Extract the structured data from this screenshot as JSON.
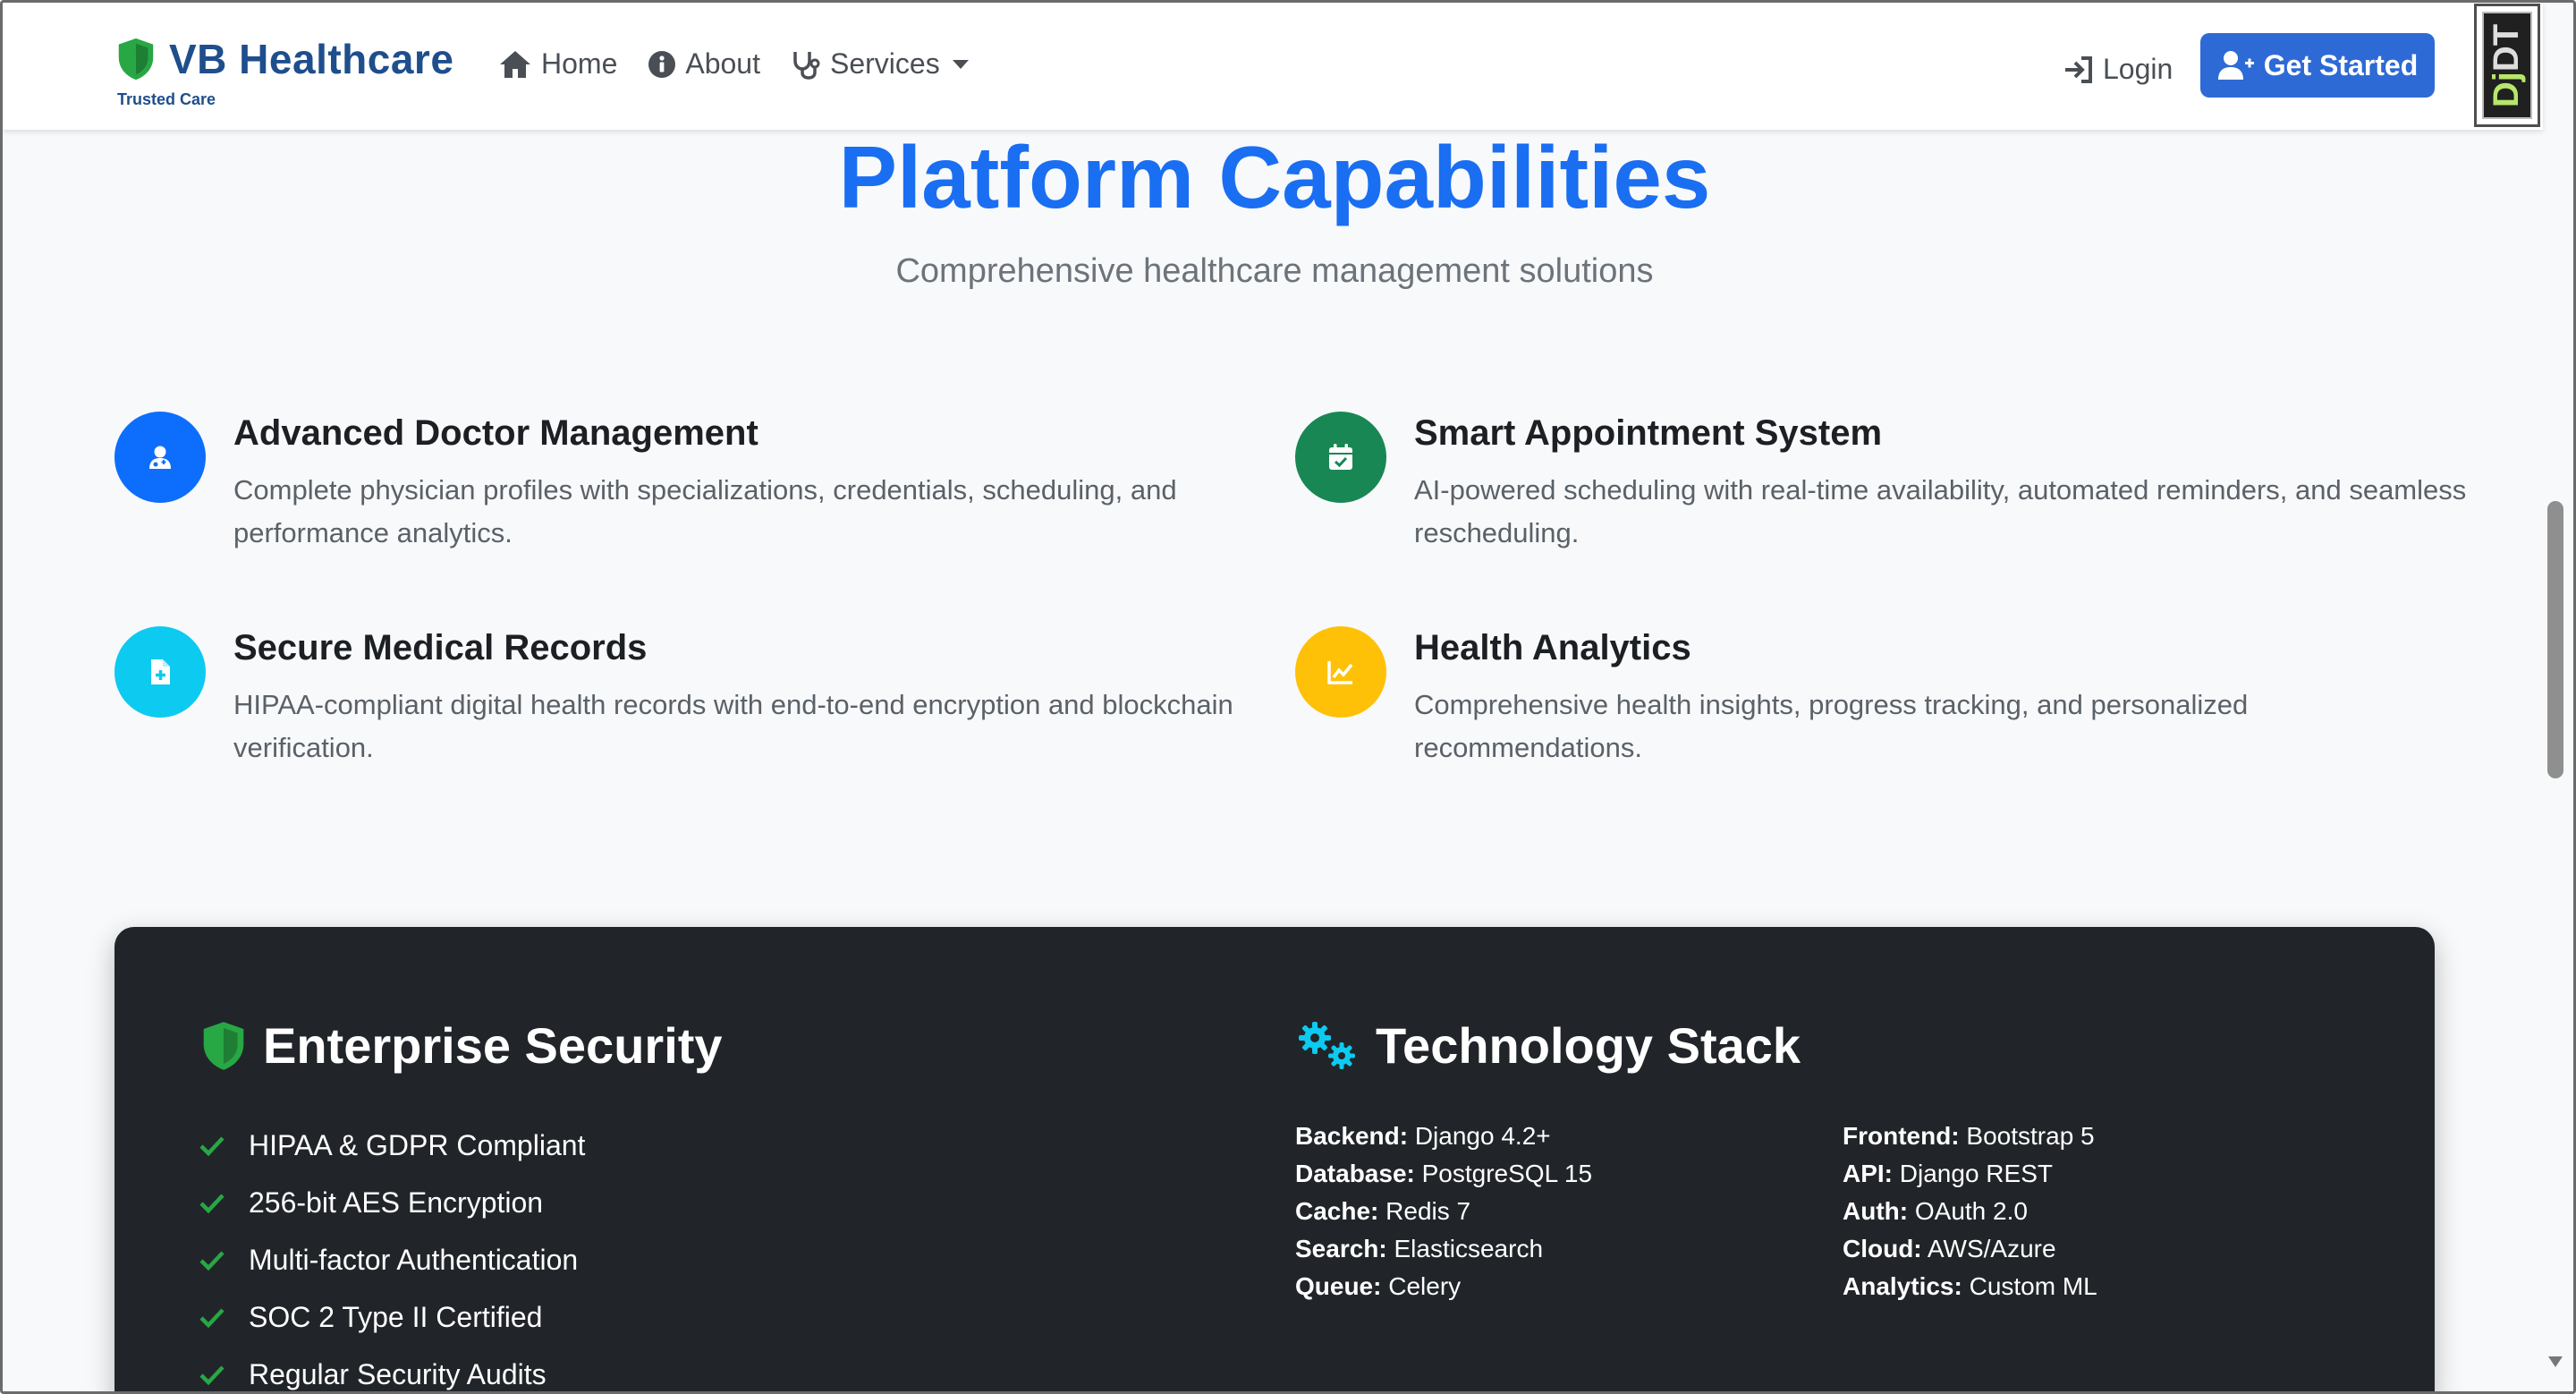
{
  "navbar": {
    "brand_name": "VB Healthcare",
    "brand_tagline": "Trusted Care",
    "links": [
      {
        "label": "Home",
        "icon": "home-icon"
      },
      {
        "label": "About",
        "icon": "info-icon"
      },
      {
        "label": "Services",
        "icon": "stethoscope-icon"
      }
    ],
    "login_label": "Login",
    "cta_label": "Get Started"
  },
  "debug_toolbar": {
    "label_prefix": "Dj",
    "label_suffix": "DT"
  },
  "capabilities": {
    "title": "Platform Capabilities",
    "subtitle": "Comprehensive healthcare management solutions",
    "features": [
      {
        "title": "Advanced Doctor Management",
        "description": "Complete physician profiles with specializations, credentials, scheduling, and performance analytics.",
        "icon": "user-doctor-icon",
        "color": "#0d6efd"
      },
      {
        "title": "Smart Appointment System",
        "description": "AI-powered scheduling with real-time availability, automated reminders, and seamless rescheduling.",
        "icon": "calendar-check-icon",
        "color": "#198754"
      },
      {
        "title": "Secure Medical Records",
        "description": "HIPAA-compliant digital health records with end-to-end encryption and blockchain verification.",
        "icon": "file-medical-icon",
        "color": "#0dcaf0"
      },
      {
        "title": "Health Analytics",
        "description": "Comprehensive health insights, progress tracking, and personalized recommendations.",
        "icon": "chart-line-icon",
        "color": "#ffc107"
      }
    ]
  },
  "security": {
    "title": "Enterprise Security",
    "items": [
      "HIPAA & GDPR Compliant",
      "256-bit AES Encryption",
      "Multi-factor Authentication",
      "SOC 2 Type II Certified",
      "Regular Security Audits"
    ]
  },
  "tech_stack": {
    "title": "Technology Stack",
    "left": [
      {
        "key": "Backend:",
        "value": "Django 4.2+"
      },
      {
        "key": "Database:",
        "value": "PostgreSQL 15"
      },
      {
        "key": "Cache:",
        "value": "Redis 7"
      },
      {
        "key": "Search:",
        "value": "Elasticsearch"
      },
      {
        "key": "Queue:",
        "value": "Celery"
      }
    ],
    "right": [
      {
        "key": "Frontend:",
        "value": "Bootstrap 5"
      },
      {
        "key": "API:",
        "value": "Django REST"
      },
      {
        "key": "Auth:",
        "value": "OAuth 2.0"
      },
      {
        "key": "Cloud:",
        "value": "AWS/Azure"
      },
      {
        "key": "Analytics:",
        "value": "Custom ML"
      }
    ]
  },
  "colors": {
    "primary": "#1a6ef2",
    "brand": "#1f4e8c",
    "success": "#198754",
    "dark": "#212529",
    "accent_cyan": "#0dcaf0"
  }
}
